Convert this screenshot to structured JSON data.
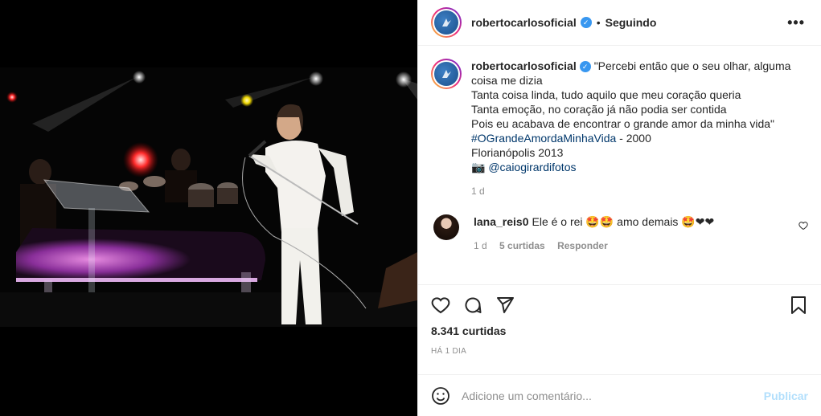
{
  "post": {
    "username": "robertocarlosoficial",
    "follow_status": "Seguindo",
    "more_glyph": "•••",
    "caption_lines": [
      "\"Percebi então que o seu olhar, alguma",
      "coisa me dizia",
      "Tanta coisa linda, tudo aquilo que meu coração queria",
      "Tanta emoção, no coração já não podia ser contida",
      "Pois eu acabava de encontrar o grande amor da minha vida\""
    ],
    "hashtag": "#OGrandeAmordaMinhaVida",
    "hashtag_suffix": " - 2000",
    "location_line": "Florianópolis 2013",
    "camera_emoji": "📷",
    "photo_credit": "@caiogirardifotos",
    "caption_age": "1 d",
    "likes": "8.341 curtidas",
    "posted_ago": "HÁ 1 DIA"
  },
  "comment": {
    "username": "lana_reis0",
    "text": "Ele é o rei 🤩🤩 amo demais 🤩❤❤",
    "age": "1 d",
    "likes": "5 curtidas",
    "reply": "Responder"
  },
  "composer": {
    "placeholder": "Adicione um comentário...",
    "publish_label": "Publicar"
  },
  "icons": {
    "like": "heart-icon",
    "comment": "comment-icon",
    "share": "send-icon",
    "save": "bookmark-icon",
    "emoji": "emoji-icon",
    "options": "more-icon",
    "verified": "verified-icon"
  },
  "colors": {
    "verified": "#3897f0",
    "hashtag_link": "#00376b",
    "muted": "#8e8e8e",
    "publish_disabled": "#b2dffc"
  }
}
